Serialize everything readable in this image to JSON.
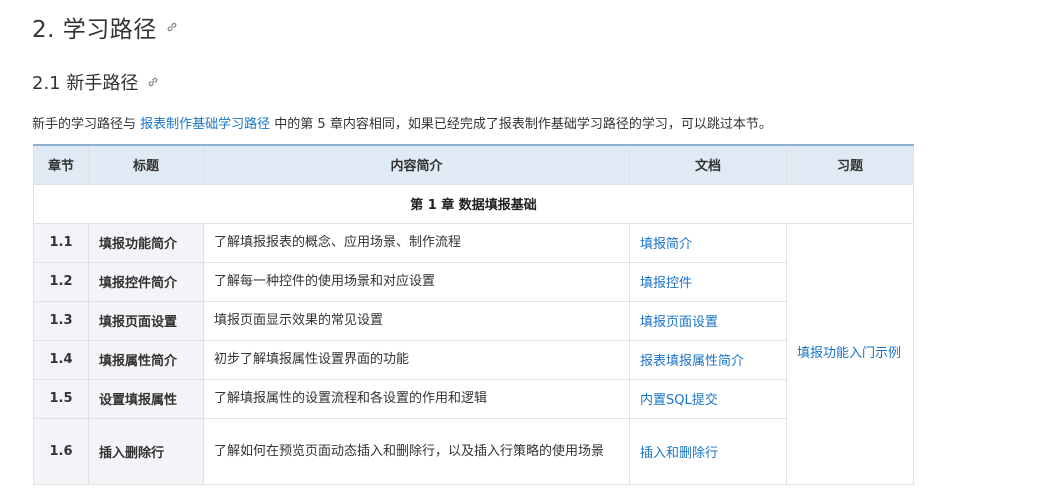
{
  "heading": {
    "text": "2. 学习路径"
  },
  "subheading": {
    "text": "2.1 新手路径"
  },
  "intro": {
    "before": "新手的学习路径与 ",
    "link": "报表制作基础学习路径",
    "after": " 中的第 5 章内容相同，如果已经完成了报表制作基础学习路径的学习，可以跳过本节。"
  },
  "table": {
    "headers": {
      "chapter": "章节",
      "title": "标题",
      "content": "内容简介",
      "doc": "文档",
      "exercise": "习题"
    },
    "chapter_row": "第 1 章 数据填报基础",
    "rows": [
      {
        "section": "1.1",
        "title": "填报功能简介",
        "desc": "了解填报报表的概念、应用场景、制作流程",
        "doc": "填报简介"
      },
      {
        "section": "1.2",
        "title": "填报控件简介",
        "desc": "了解每一种控件的使用场景和对应设置",
        "doc": "填报控件"
      },
      {
        "section": "1.3",
        "title": "填报页面设置",
        "desc": "填报页面显示效果的常见设置",
        "doc": "填报页面设置"
      },
      {
        "section": "1.4",
        "title": "填报属性简介",
        "desc": "初步了解填报属性设置界面的功能",
        "doc": "报表填报属性简介"
      },
      {
        "section": "1.5",
        "title": "设置填报属性",
        "desc": "了解填报属性的设置流程和各设置的作用和逻辑",
        "doc": "内置SQL提交"
      },
      {
        "section": "1.6",
        "title": "插入删除行",
        "desc": "了解如何在预览页面动态插入和删除行，以及插入行策略的使用场景",
        "doc": "插入和删除行"
      }
    ],
    "exercise": "填报功能入门示例"
  }
}
